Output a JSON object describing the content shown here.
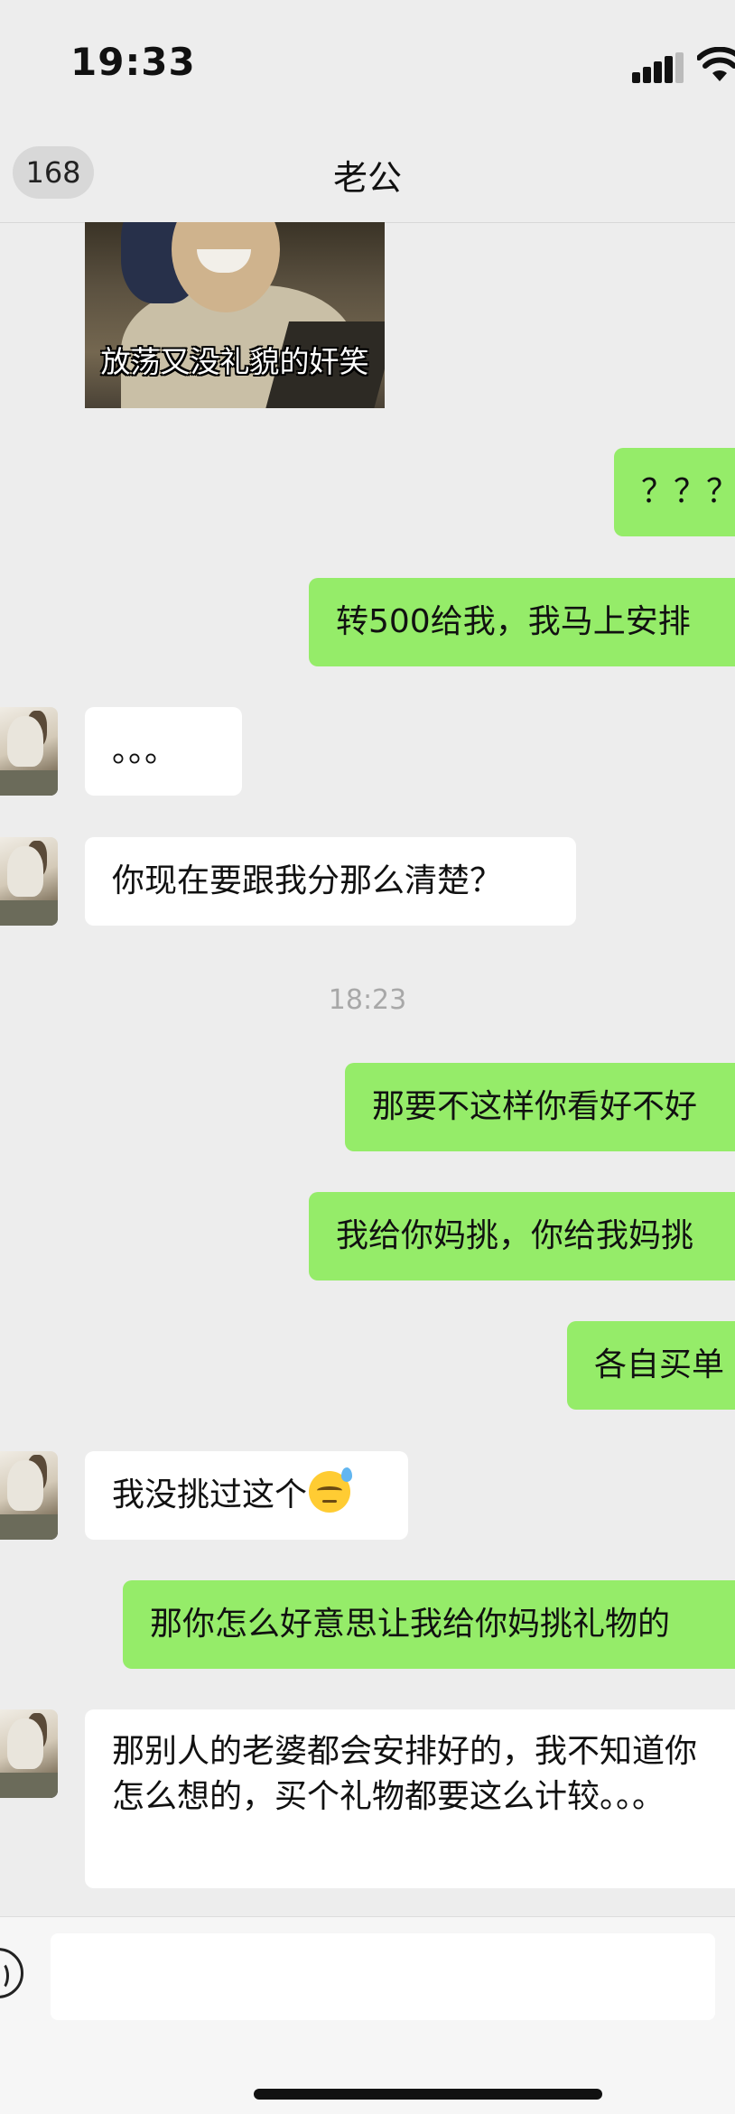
{
  "status_bar": {
    "time": "19:33"
  },
  "header": {
    "unread_count": "168",
    "title": "老公"
  },
  "sticker": {
    "caption": "放荡又没礼貌的奸笑"
  },
  "messages": [
    {
      "side": "sent",
      "text": "？？？"
    },
    {
      "side": "sent",
      "text": "转500给我，我马上安排"
    },
    {
      "side": "recv",
      "text": "。。。"
    },
    {
      "side": "recv",
      "text": "你现在要跟我分那么清楚？"
    },
    {
      "side": "sent",
      "text": "那要不这样你看好不好"
    },
    {
      "side": "sent",
      "text": "我给你妈挑，你给我妈挑"
    },
    {
      "side": "sent",
      "text": "各自买单"
    },
    {
      "side": "recv",
      "text": "我没挑过这个",
      "emoji": "sleepy-sweat-emoji"
    },
    {
      "side": "sent",
      "text": "那你怎么好意思让我给你妈挑礼物的"
    },
    {
      "side": "recv",
      "text": "那别人的老婆都会安排好的，我不知道你怎么想的，买个礼物都要这么计较。。。"
    }
  ],
  "timestamp": "18:23",
  "input": {
    "value": ""
  }
}
